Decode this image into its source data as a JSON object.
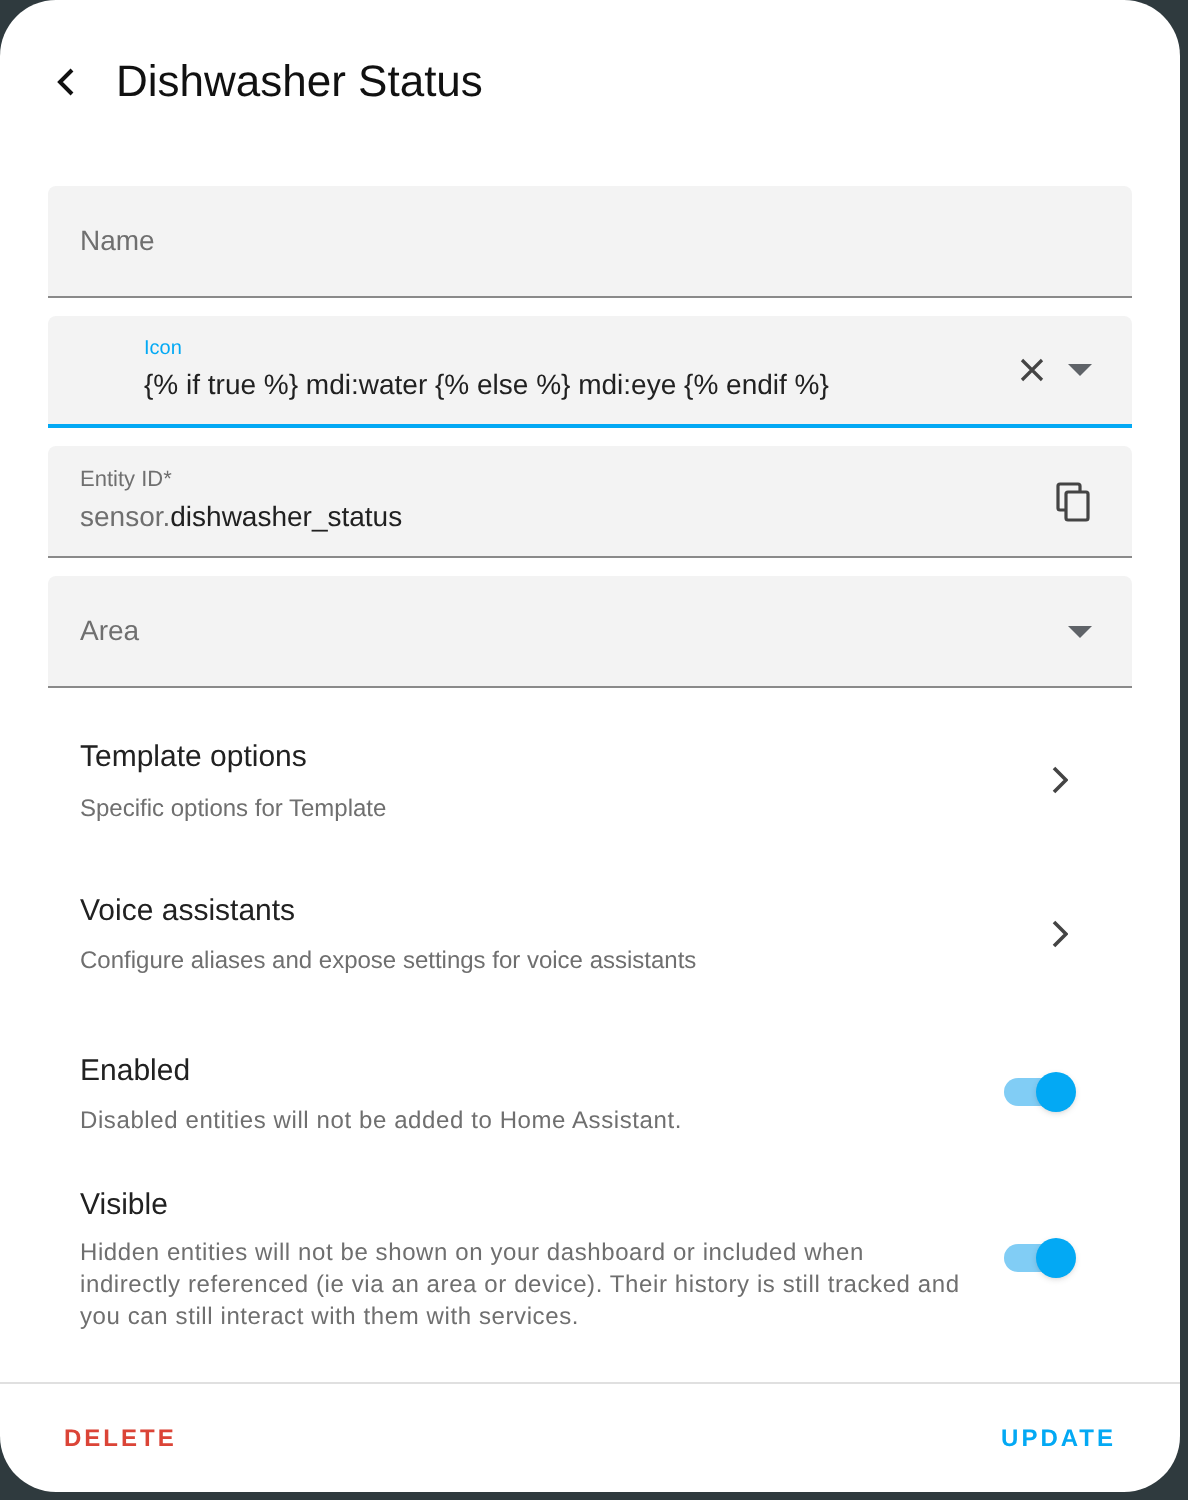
{
  "dialog": {
    "title": "Dishwasher Status"
  },
  "fields": [
    {
      "kind": "text",
      "label": "Name",
      "focused": false
    },
    {
      "kind": "combo",
      "label": "Icon",
      "value": "{% if true %} mdi:water {% else %} mdi:eye {% endif %}",
      "focused": true
    },
    {
      "kind": "copy",
      "label": "Entity ID*",
      "value_prefix": "sensor.",
      "value": "dishwasher_status",
      "focused": false
    },
    {
      "kind": "select",
      "label": "Area",
      "focused": false
    }
  ],
  "links": [
    {
      "title": "Template options",
      "description": "Specific options for Template"
    },
    {
      "title": "Voice assistants",
      "description": "Configure aliases and expose settings for voice assistants"
    }
  ],
  "toggles": [
    {
      "title": "Enabled",
      "description": "Disabled entities will not be added to Home Assistant.",
      "on": true
    },
    {
      "title": "Visible",
      "description": "Hidden entities will not be shown on your dashboard or included when indirectly referenced (ie via an area or device). Their history is still tracked and you can still interact with them with services.",
      "on": true
    }
  ],
  "footer": {
    "delete": "DELETE",
    "update": "UPDATE"
  }
}
